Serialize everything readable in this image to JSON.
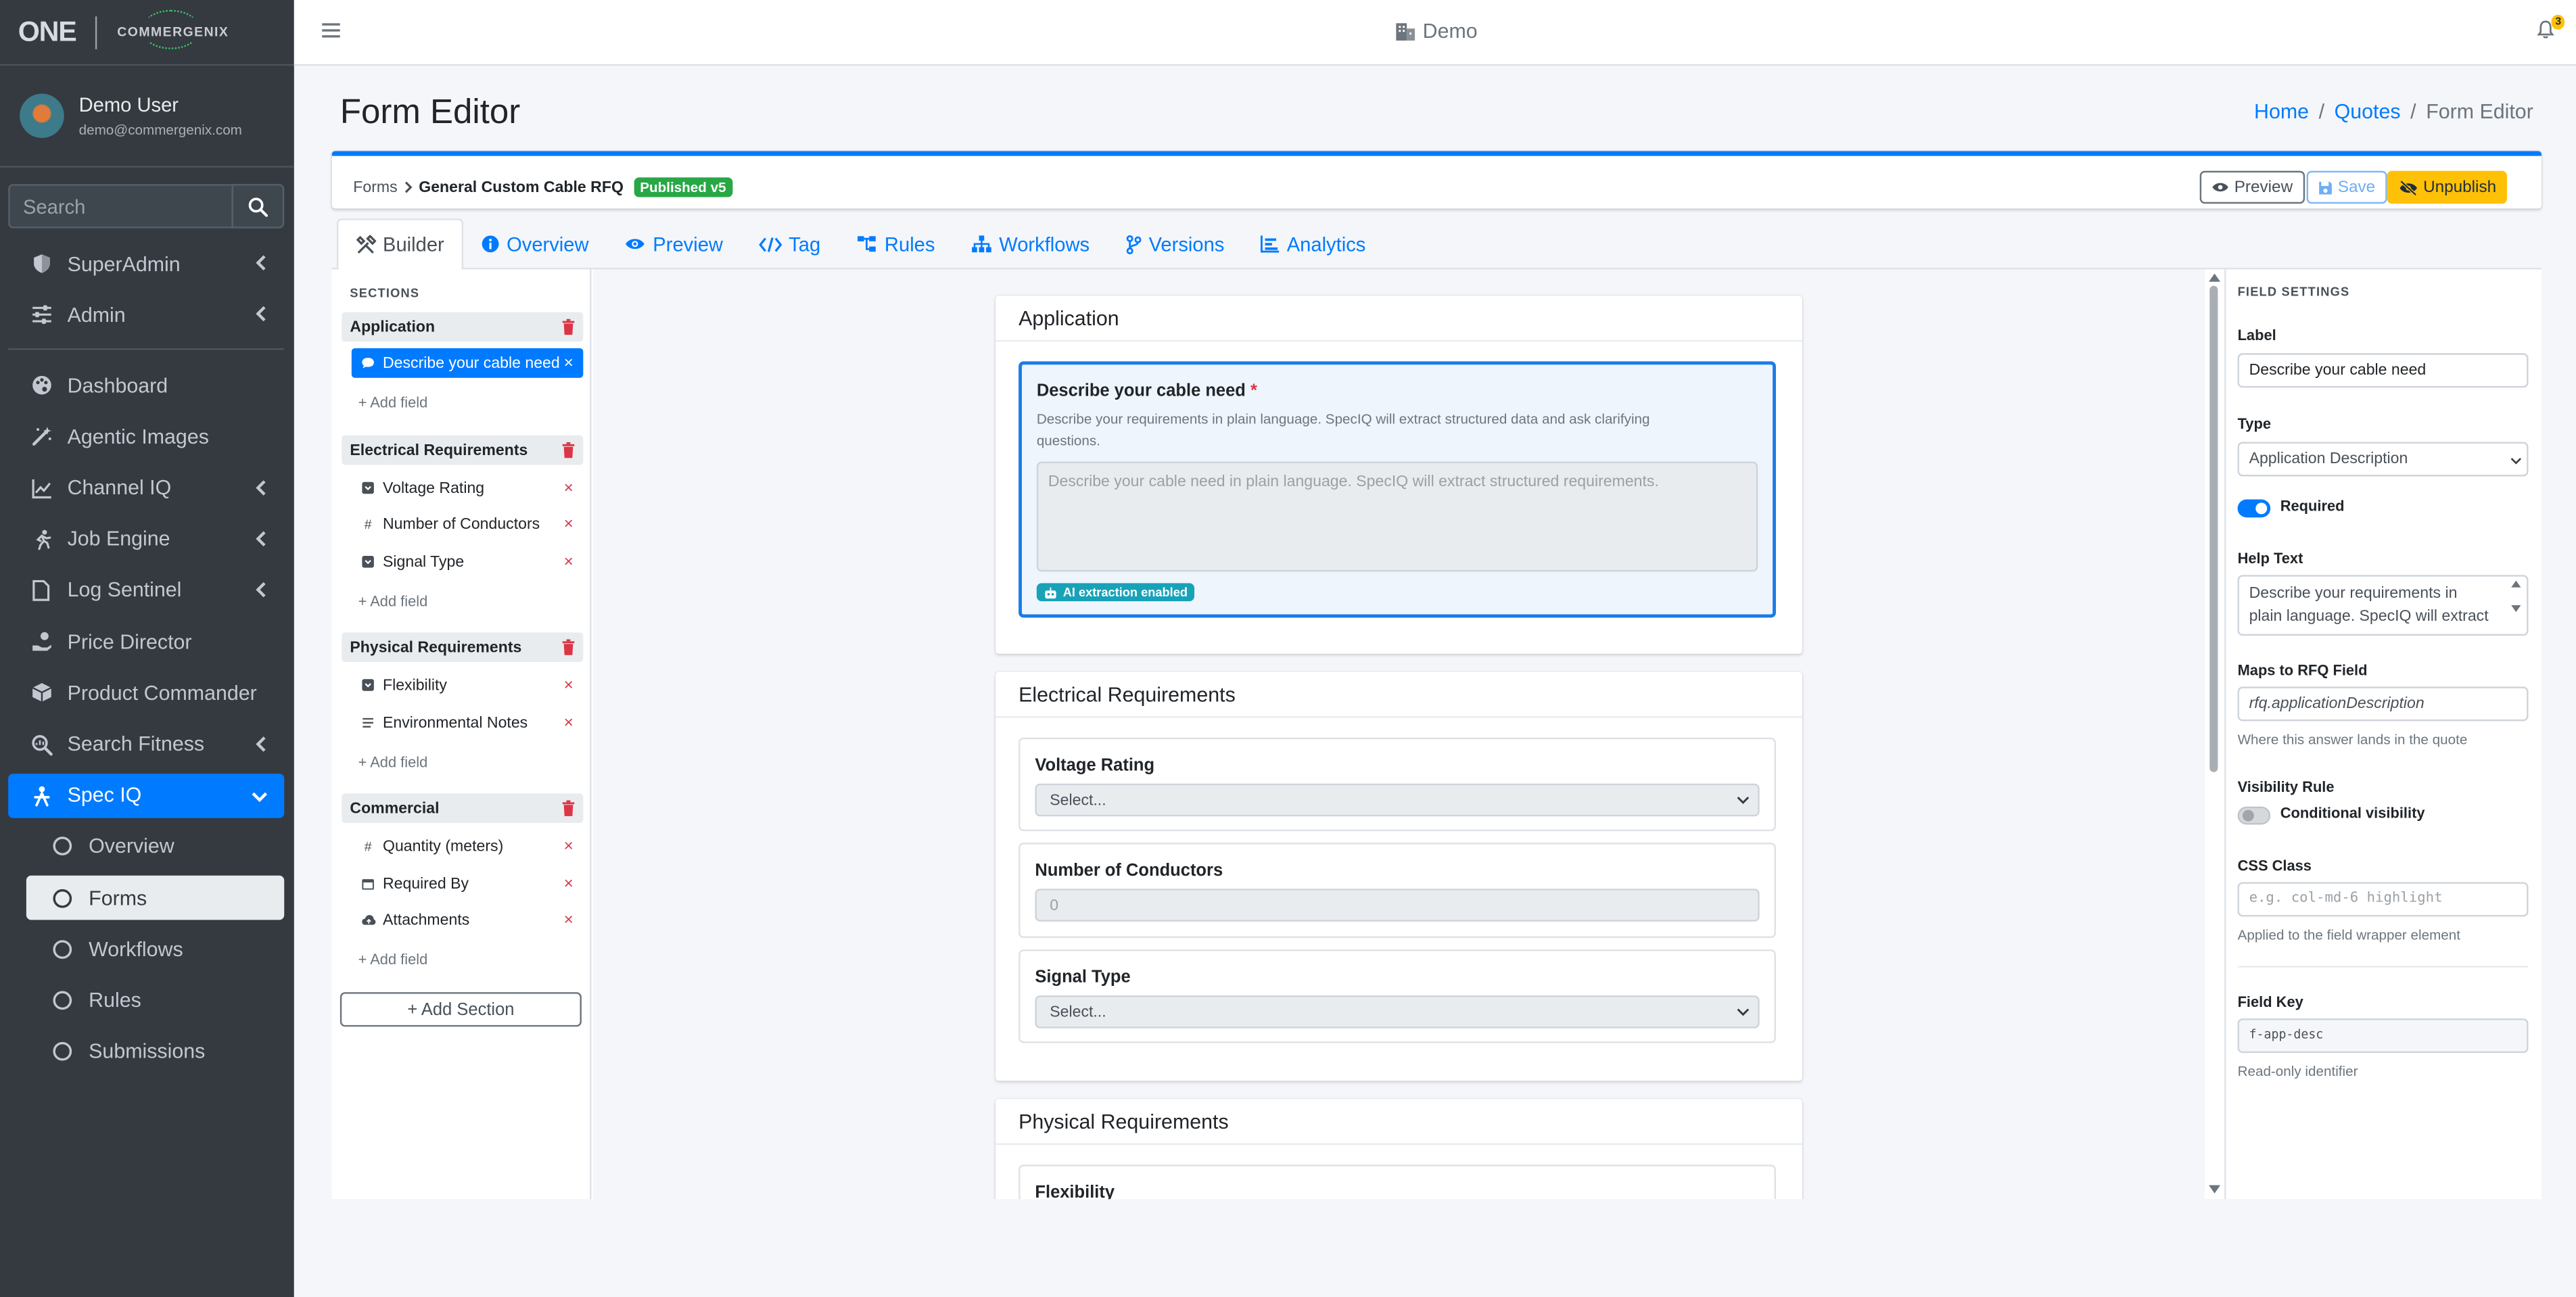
{
  "app": {
    "brand_one": "ONE",
    "brand_company": "COMMERGENIX",
    "user_name": "Demo User",
    "user_email": "demo@commergenix.com",
    "search_placeholder": "Search",
    "header_tenant": "Demo",
    "notification_count": "3"
  },
  "sidebar": {
    "items": [
      {
        "label": "SuperAdmin",
        "icon": "shield-icon"
      },
      {
        "label": "Admin",
        "icon": "sliders-icon"
      },
      {
        "label": "Dashboard",
        "icon": "palette-icon"
      },
      {
        "label": "Agentic Images",
        "icon": "magic-wand-icon"
      },
      {
        "label": "Channel IQ",
        "icon": "line-chart-icon"
      },
      {
        "label": "Job Engine",
        "icon": "runner-icon"
      },
      {
        "label": "Log Sentinel",
        "icon": "file-icon"
      },
      {
        "label": "Price Director",
        "icon": "hand-coin-icon"
      },
      {
        "label": "Product Commander",
        "icon": "box-icon"
      },
      {
        "label": "Search Fitness",
        "icon": "search-chart-icon"
      },
      {
        "label": "Spec IQ",
        "icon": "person-icon"
      }
    ],
    "sub_items": [
      "Overview",
      "Forms",
      "Workflows",
      "Rules",
      "Submissions"
    ]
  },
  "page": {
    "title": "Form Editor",
    "breadcrumb": [
      "Home",
      "Quotes",
      "Form Editor"
    ]
  },
  "form_header": {
    "path_root": "Forms",
    "form_name": "General Custom Cable RFQ",
    "status_badge": "Published v5",
    "preview_label": "Preview",
    "save_label": "Save",
    "unpublish_label": "Unpublish"
  },
  "tabs": [
    "Builder",
    "Overview",
    "Preview",
    "Tag",
    "Rules",
    "Workflows",
    "Versions",
    "Analytics"
  ],
  "sections_panel": {
    "heading": "SECTIONS",
    "add_field": "+ Add field",
    "add_section": "+ Add Section",
    "sections": [
      {
        "name": "Application",
        "fields": [
          {
            "label": "Describe your cable need",
            "icon": "comment-icon"
          }
        ]
      },
      {
        "name": "Electrical Requirements",
        "fields": [
          {
            "label": "Voltage Rating",
            "icon": "select-icon"
          },
          {
            "label": "Number of Conductors",
            "icon": "hash-icon"
          },
          {
            "label": "Signal Type",
            "icon": "select-icon"
          }
        ]
      },
      {
        "name": "Physical Requirements",
        "fields": [
          {
            "label": "Flexibility",
            "icon": "select-icon"
          },
          {
            "label": "Environmental Notes",
            "icon": "lines-icon"
          }
        ]
      },
      {
        "name": "Commercial",
        "fields": [
          {
            "label": "Quantity (meters)",
            "icon": "hash-icon"
          },
          {
            "label": "Required By",
            "icon": "calendar-icon"
          },
          {
            "label": "Attachments",
            "icon": "cloud-upload-icon"
          }
        ]
      }
    ]
  },
  "canvas": {
    "application": {
      "title": "Application",
      "field_label": "Describe your cable need",
      "required_mark": "*",
      "help": "Describe your requirements in plain language. SpecIQ will extract structured data and ask clarifying questions.",
      "placeholder": "Describe your cable need in plain language. SpecIQ will extract structured requirements.",
      "ai_badge": "AI extraction enabled"
    },
    "electrical": {
      "title": "Electrical Requirements",
      "voltage_label": "Voltage Rating",
      "voltage_value": "Select...",
      "conductors_label": "Number of Conductors",
      "conductors_value": "0",
      "signal_label": "Signal Type",
      "signal_value": "Select..."
    },
    "physical": {
      "title": "Physical Requirements",
      "flex_label": "Flexibility"
    }
  },
  "settings": {
    "heading": "FIELD SETTINGS",
    "label_title": "Label",
    "label_value": "Describe your cable need",
    "type_title": "Type",
    "type_value": "Application Description",
    "required_label": "Required",
    "required_on": true,
    "help_title": "Help Text",
    "help_value": "Describe your requirements in plain language. SpecIQ will extract",
    "maps_title": "Maps to RFQ Field",
    "maps_value": "rfq.applicationDescription",
    "maps_hint": "Where this answer lands in the quote",
    "vis_title": "Visibility Rule",
    "vis_label": "Conditional visibility",
    "vis_on": false,
    "css_title": "CSS Class",
    "css_placeholder": "e.g. col-md-6 highlight",
    "css_hint": "Applied to the field wrapper element",
    "key_title": "Field Key",
    "key_value": "f-app-desc",
    "key_hint": "Read-only identifier"
  },
  "colors": {
    "primary": "#007bff",
    "sidebar_bg": "#343a40",
    "success": "#28a745",
    "warning": "#ffc107",
    "danger": "#dc3545",
    "info": "#17a2b8"
  }
}
